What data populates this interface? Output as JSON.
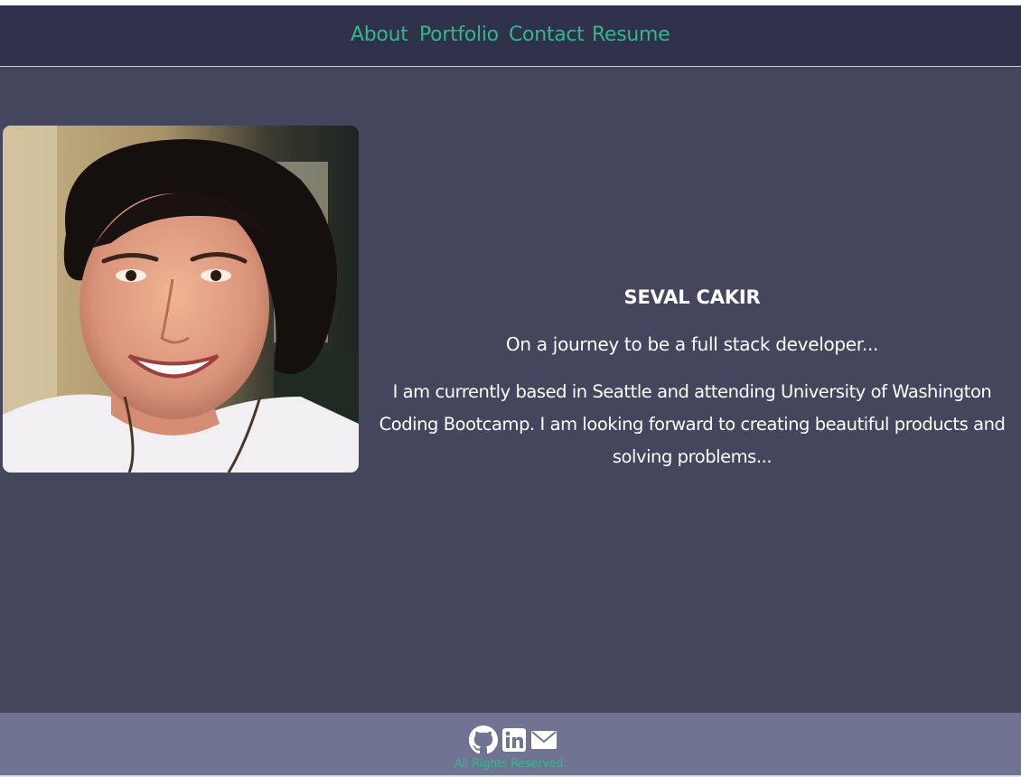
{
  "nav": {
    "links": [
      {
        "label": "About"
      },
      {
        "label": "Portfolio"
      },
      {
        "label": "Contact"
      },
      {
        "label": "Resume"
      }
    ]
  },
  "profile": {
    "name": "SEVAL CAKIR",
    "tagline": "On a journey to be a full stack developer...",
    "about": "I am currently based in Seattle and attending University of Washington Coding Bootcamp. I am looking forward to creating beautiful products and solving problems..."
  },
  "footer": {
    "icons": [
      "github-icon",
      "linkedin-icon",
      "email-icon"
    ],
    "rights": "All Rights Reserved."
  },
  "colors": {
    "nav_bg": "#2f3049",
    "main_bg": "#43465d",
    "footer_bg": "#6e7491",
    "accent": "#34b58f",
    "text": "#ffffff"
  }
}
